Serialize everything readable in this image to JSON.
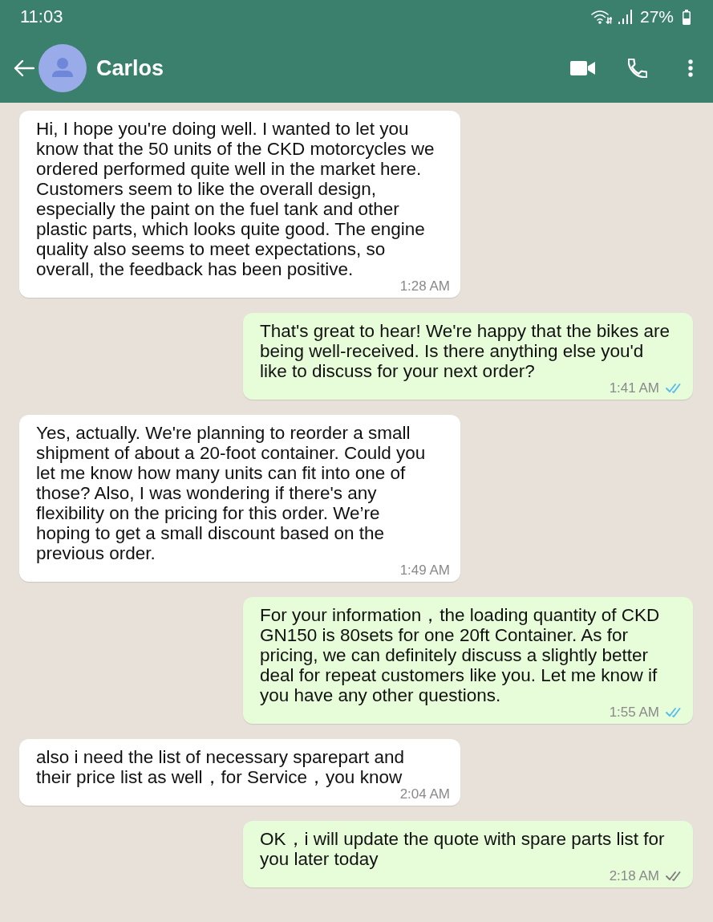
{
  "status_bar": {
    "time": "11:03",
    "battery": "27%"
  },
  "header": {
    "contact_name": "Carlos"
  },
  "messages": [
    {
      "kind": "incoming",
      "text": "Hi, I hope you're doing well. I wanted to let you know that the 50 units of the CKD motorcycles we ordered performed quite well in the market here. Customers seem to like the overall design, especially the paint on the fuel tank and other plastic parts, which looks quite good. The engine quality also seems to meet expectations, so overall, the feedback has been positive.",
      "time": "1:28 AM"
    },
    {
      "kind": "outgoing",
      "text": "That's great to hear! We're happy that the bikes are being well-received. Is there anything else you'd like to discuss for your next order?",
      "time": "1:41 AM",
      "read": true
    },
    {
      "kind": "incoming",
      "text": "Yes, actually. We're planning to reorder a small shipment of about a 20-foot container. Could you let me know how many units can fit into one of those? Also, I was wondering if there's any flexibility on the pricing for this order. We’re hoping to get a small discount based on the previous order.",
      "time": "1:49 AM"
    },
    {
      "kind": "outgoing",
      "text": "For your information，the loading quantity of CKD GN150 is 80sets for one 20ft Container. As for pricing, we can definitely discuss a slightly better deal for repeat customers like you. Let me know if you have any other questions.",
      "time": "1:55 AM",
      "read": true
    },
    {
      "kind": "incoming",
      "text": "also i need the list of necessary sparepart and their price list as well，for Service，you know",
      "time": "2:04 AM"
    },
    {
      "kind": "outgoing",
      "text": "OK，i will update the quote with spare parts list for you later today",
      "time": "2:18 AM",
      "read": false
    }
  ]
}
